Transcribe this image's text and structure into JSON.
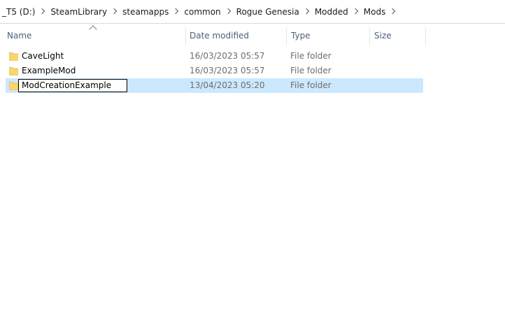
{
  "breadcrumb": [
    {
      "label": "_T5 (D:)"
    },
    {
      "label": "SteamLibrary"
    },
    {
      "label": "steamapps"
    },
    {
      "label": "common"
    },
    {
      "label": "Rogue Genesia"
    },
    {
      "label": "Modded"
    },
    {
      "label": "Mods"
    }
  ],
  "columns": {
    "name": "Name",
    "date": "Date modified",
    "type": "Type",
    "size": "Size"
  },
  "files": [
    {
      "name": "CaveLight",
      "date": "16/03/2023 05:57",
      "type": "File folder",
      "icon": "folder-icon"
    },
    {
      "name": "ExampleMod",
      "date": "16/03/2023 05:57",
      "type": "File folder",
      "icon": "folder-icon"
    },
    {
      "name": "ModCreationExample",
      "date": "13/04/2023 05:20",
      "type": "File folder",
      "icon": "folder-icon",
      "selected": true,
      "renaming": true
    }
  ],
  "colors": {
    "selection": "#cce8ff",
    "header_text": "#4c607a",
    "folder_yellow": "#f8d775"
  }
}
